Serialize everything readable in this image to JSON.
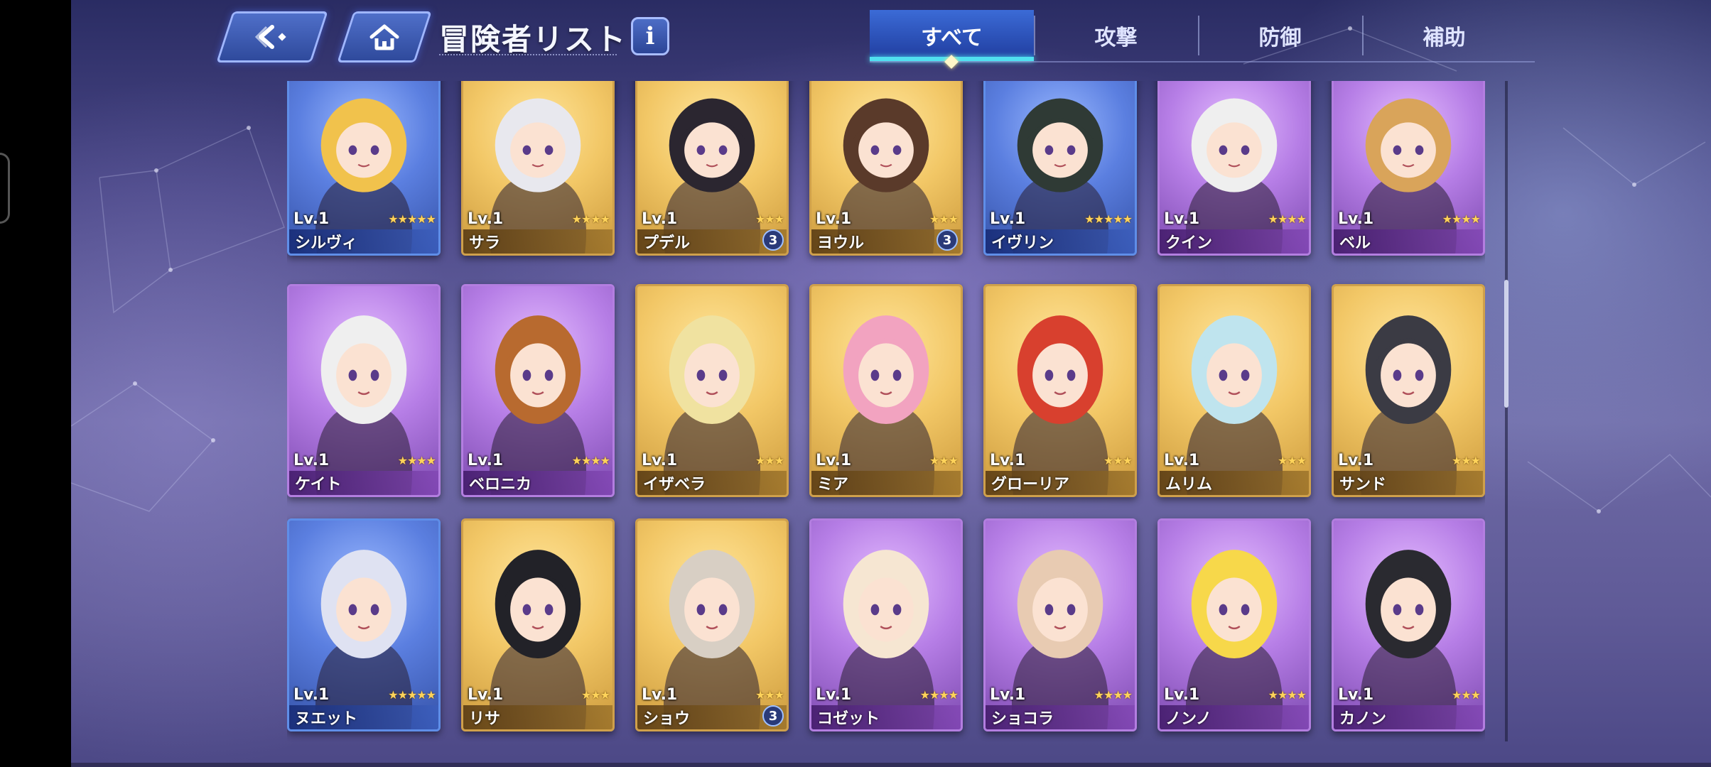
{
  "header": {
    "title": "冒険者リスト",
    "info_label": "i",
    "tabs": [
      {
        "label": "すべて",
        "active": true
      },
      {
        "label": "攻撃",
        "active": false
      },
      {
        "label": "防御",
        "active": false
      },
      {
        "label": "補助",
        "active": false
      }
    ]
  },
  "cards": [
    {
      "name": "シルヴィ",
      "level": "Lv.1",
      "stars": 5,
      "rarity": "blue"
    },
    {
      "name": "サラ",
      "level": "Lv.1",
      "stars": 4,
      "rarity": "gold"
    },
    {
      "name": "プデル",
      "level": "Lv.1",
      "stars": 3,
      "rarity": "gold",
      "badge": "3"
    },
    {
      "name": "ヨウル",
      "level": "Lv.1",
      "stars": 3,
      "rarity": "gold",
      "badge": "3"
    },
    {
      "name": "イヴリン",
      "level": "Lv.1",
      "stars": 5,
      "rarity": "blue"
    },
    {
      "name": "クイン",
      "level": "Lv.1",
      "stars": 4,
      "rarity": "purple"
    },
    {
      "name": "ベル",
      "level": "Lv.1",
      "stars": 4,
      "rarity": "purple"
    },
    {
      "name": "ケイト",
      "level": "Lv.1",
      "stars": 4,
      "rarity": "purple"
    },
    {
      "name": "ベロニカ",
      "level": "Lv.1",
      "stars": 4,
      "rarity": "purple"
    },
    {
      "name": "イザベラ",
      "level": "Lv.1",
      "stars": 3,
      "rarity": "gold"
    },
    {
      "name": "ミア",
      "level": "Lv.1",
      "stars": 3,
      "rarity": "gold"
    },
    {
      "name": "グローリア",
      "level": "Lv.1",
      "stars": 3,
      "rarity": "gold"
    },
    {
      "name": "ムリム",
      "level": "Lv.1",
      "stars": 3,
      "rarity": "gold"
    },
    {
      "name": "サンド",
      "level": "Lv.1",
      "stars": 3,
      "rarity": "gold"
    },
    {
      "name": "ヌエット",
      "level": "Lv.1",
      "stars": 5,
      "rarity": "blue"
    },
    {
      "name": "リサ",
      "level": "Lv.1",
      "stars": 3,
      "rarity": "gold"
    },
    {
      "name": "ショウ",
      "level": "Lv.1",
      "stars": 3,
      "rarity": "gold",
      "badge": "3"
    },
    {
      "name": "コゼット",
      "level": "Lv.1",
      "stars": 4,
      "rarity": "purple"
    },
    {
      "name": "ショコラ",
      "level": "Lv.1",
      "stars": 4,
      "rarity": "purple"
    },
    {
      "name": "ノンノ",
      "level": "Lv.1",
      "stars": 4,
      "rarity": "purple"
    },
    {
      "name": "カノン",
      "level": "Lv.1",
      "stars": 3,
      "rarity": "purple"
    }
  ],
  "colors": {
    "accent": "#50e0f0",
    "tab_active": "#3a6fd8",
    "gold_frame": "#cfa04b",
    "blue_frame": "#5f8ee8",
    "purple_frame": "#b37ee0"
  },
  "icons": {
    "back": "back-arrow-icon",
    "home": "home-icon",
    "info": "info-icon",
    "star": "★"
  }
}
